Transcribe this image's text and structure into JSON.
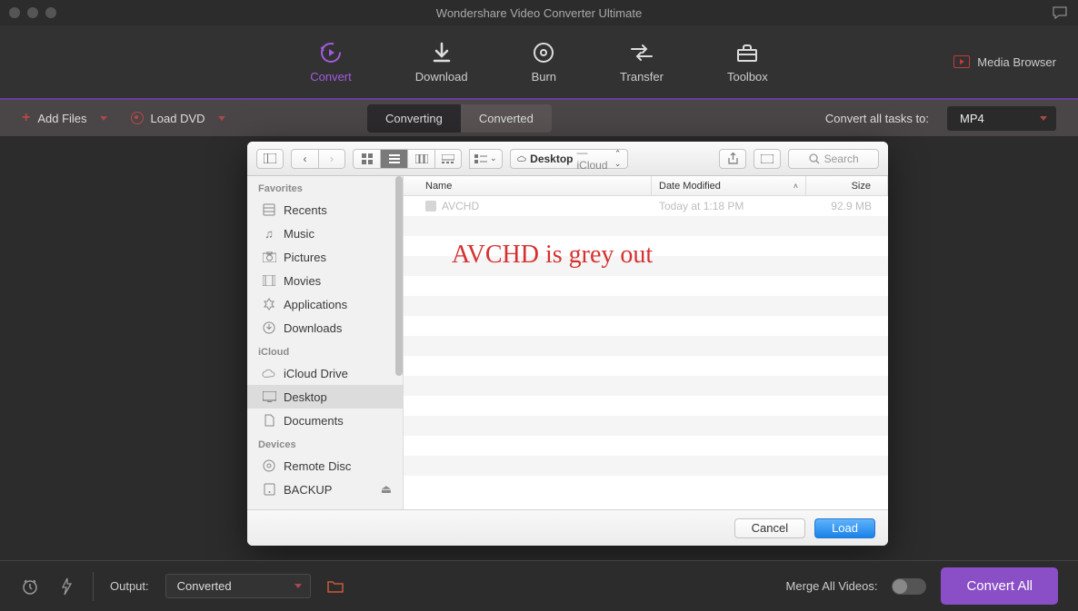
{
  "titlebar": {
    "title": "Wondershare Video Converter Ultimate"
  },
  "mainTabs": {
    "convert": "Convert",
    "download": "Download",
    "burn": "Burn",
    "transfer": "Transfer",
    "toolbox": "Toolbox"
  },
  "mediaBrowser": "Media Browser",
  "toolbar": {
    "addFiles": "Add Files",
    "loadDVD": "Load DVD"
  },
  "centerTabs": {
    "converting": "Converting",
    "converted": "Converted"
  },
  "convertAllLabel": "Convert all tasks to:",
  "convertAllFormat": "MP4",
  "finder": {
    "location": "Desktop",
    "locationSuffix": " — iCloud",
    "searchPlaceholder": "Search",
    "sections": {
      "favorites": "Favorites",
      "icloud": "iCloud",
      "devices": "Devices"
    },
    "sidebar": {
      "favorites": [
        "Recents",
        "Music",
        "Pictures",
        "Movies",
        "Applications",
        "Downloads"
      ],
      "icloud": [
        "iCloud Drive",
        "Desktop",
        "Documents"
      ],
      "devices": [
        "Remote Disc",
        "BACKUP"
      ]
    },
    "columns": {
      "name": "Name",
      "date": "Date Modified",
      "size": "Size"
    },
    "rows": [
      {
        "name": "AVCHD",
        "date": "Today at 1:18 PM",
        "size": "92.9 MB"
      }
    ],
    "footer": {
      "cancel": "Cancel",
      "load": "Load"
    }
  },
  "annotation": "AVCHD is grey out",
  "bottom": {
    "outputLabel": "Output:",
    "outputValue": "Converted",
    "mergeLabel": "Merge All Videos:",
    "convertAll": "Convert All"
  }
}
